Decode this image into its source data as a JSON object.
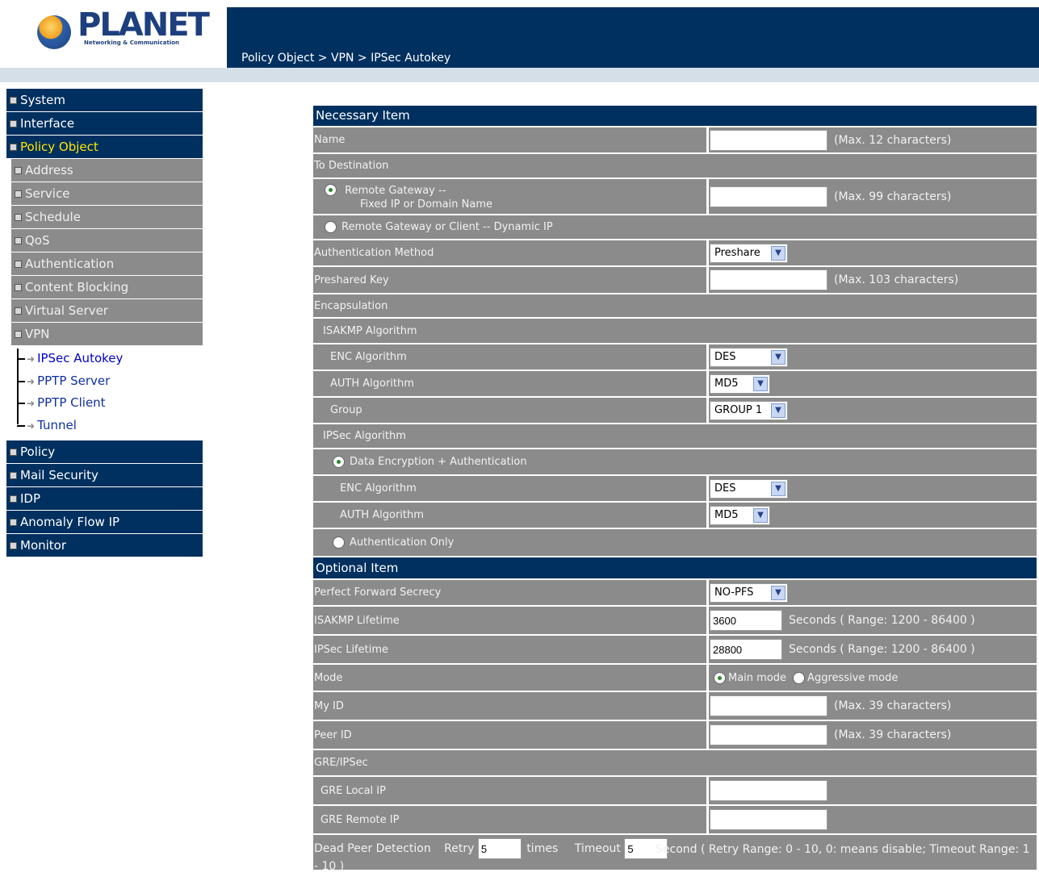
{
  "header": {
    "brand": "PLANET",
    "tagline": "Networking & Communication",
    "breadcrumb": "Policy Object > VPN > IPSec Autokey"
  },
  "sidebar": {
    "items": [
      {
        "label": "System"
      },
      {
        "label": "Interface"
      },
      {
        "label": "Policy Object",
        "active": true
      }
    ],
    "subitems": [
      {
        "label": "Address"
      },
      {
        "label": "Service"
      },
      {
        "label": "Schedule"
      },
      {
        "label": "QoS"
      },
      {
        "label": "Authentication"
      },
      {
        "label": "Content Blocking"
      },
      {
        "label": "Virtual Server"
      },
      {
        "label": "VPN"
      }
    ],
    "vpn_links": [
      {
        "label": "IPSec Autokey"
      },
      {
        "label": "PPTP Server"
      },
      {
        "label": "PPTP Client"
      },
      {
        "label": "Tunnel"
      }
    ],
    "items_after": [
      {
        "label": "Policy"
      },
      {
        "label": "Mail Security"
      },
      {
        "label": "IDP"
      },
      {
        "label": "Anomaly Flow IP"
      },
      {
        "label": "Monitor"
      }
    ]
  },
  "form": {
    "necessary_header": "Necessary Item",
    "name_label": "Name",
    "name_value": "",
    "name_hint": "(Max. 12 characters)",
    "to_destination": "To Destination",
    "remote_gateway_label": "Remote Gateway --",
    "remote_gateway_sub": "Fixed IP or Domain Name",
    "remote_gateway_value": "",
    "remote_gateway_hint": "(Max. 99 characters)",
    "remote_dynamic_label": "Remote Gateway or Client -- Dynamic IP",
    "auth_method_label": "Authentication Method",
    "auth_method_value": "Preshare",
    "preshared_key_label": "Preshared Key",
    "preshared_key_value": "",
    "preshared_key_hint": "(Max. 103 characters)",
    "encapsulation": "Encapsulation",
    "isakmp_algorithm": "ISAKMP Algorithm",
    "isakmp_enc_label": "ENC Algorithm",
    "isakmp_enc_value": "DES",
    "isakmp_auth_label": "AUTH Algorithm",
    "isakmp_auth_value": "MD5",
    "group_label": "Group",
    "group_value": "GROUP 1",
    "ipsec_algorithm": "IPSec Algorithm",
    "data_enc_auth_label": "Data Encryption + Authentication",
    "ipsec_enc_label": "ENC Algorithm",
    "ipsec_enc_value": "DES",
    "ipsec_auth_label": "AUTH Algorithm",
    "ipsec_auth_value": "MD5",
    "auth_only_label": "Authentication Only",
    "optional_header": "Optional Item",
    "pfs_label": "Perfect Forward Secrecy",
    "pfs_value": "NO-PFS",
    "isakmp_lifetime_label": "ISAKMP Lifetime",
    "isakmp_lifetime_value": "3600",
    "isakmp_lifetime_hint": "Seconds  ( Range: 1200 - 86400 )",
    "ipsec_lifetime_label": "IPSec Lifetime",
    "ipsec_lifetime_value": "28800",
    "ipsec_lifetime_hint": "Seconds  ( Range: 1200 - 86400 )",
    "mode_label": "Mode",
    "mode_main": "Main mode",
    "mode_aggressive": "Aggressive mode",
    "my_id_label": "My ID",
    "my_id_value": "",
    "my_id_hint": "(Max. 39 characters)",
    "peer_id_label": "Peer ID",
    "peer_id_value": "",
    "peer_id_hint": "(Max. 39 characters)",
    "gre_ipsec": "GRE/IPSec",
    "gre_local_label": "GRE Local IP",
    "gre_local_value": "",
    "gre_remote_label": "GRE Remote IP",
    "gre_remote_value": "",
    "dpd_label": "Dead Peer Detection",
    "dpd_retry_label": "Retry",
    "dpd_retry_value": "5",
    "dpd_times": "times",
    "dpd_timeout_label": "Timeout",
    "dpd_timeout_value": "5",
    "dpd_hint": "Second ( Retry Range: 0 - 10, 0: means disable; Timeout Range: 1 - 10 )"
  }
}
